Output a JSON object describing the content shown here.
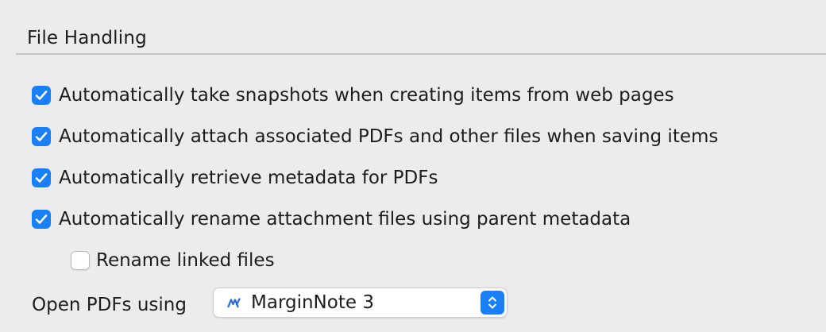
{
  "section": {
    "title": "File Handling"
  },
  "options": [
    {
      "label": "Automatically take snapshots when creating items from web pages",
      "checked": true
    },
    {
      "label": "Automatically attach associated PDFs and other files when saving items",
      "checked": true
    },
    {
      "label": "Automatically retrieve metadata for PDFs",
      "checked": true
    },
    {
      "label": "Automatically rename attachment files using parent metadata",
      "checked": true
    },
    {
      "label": "Rename linked files",
      "checked": false
    }
  ],
  "open_pdfs": {
    "label": "Open PDFs using",
    "selected": "MarginNote 3",
    "app_icon": "marginnote-icon"
  },
  "colors": {
    "accent": "#1a80f7",
    "background": "#ececec",
    "marginnote_brand": "#2f6fd6"
  }
}
